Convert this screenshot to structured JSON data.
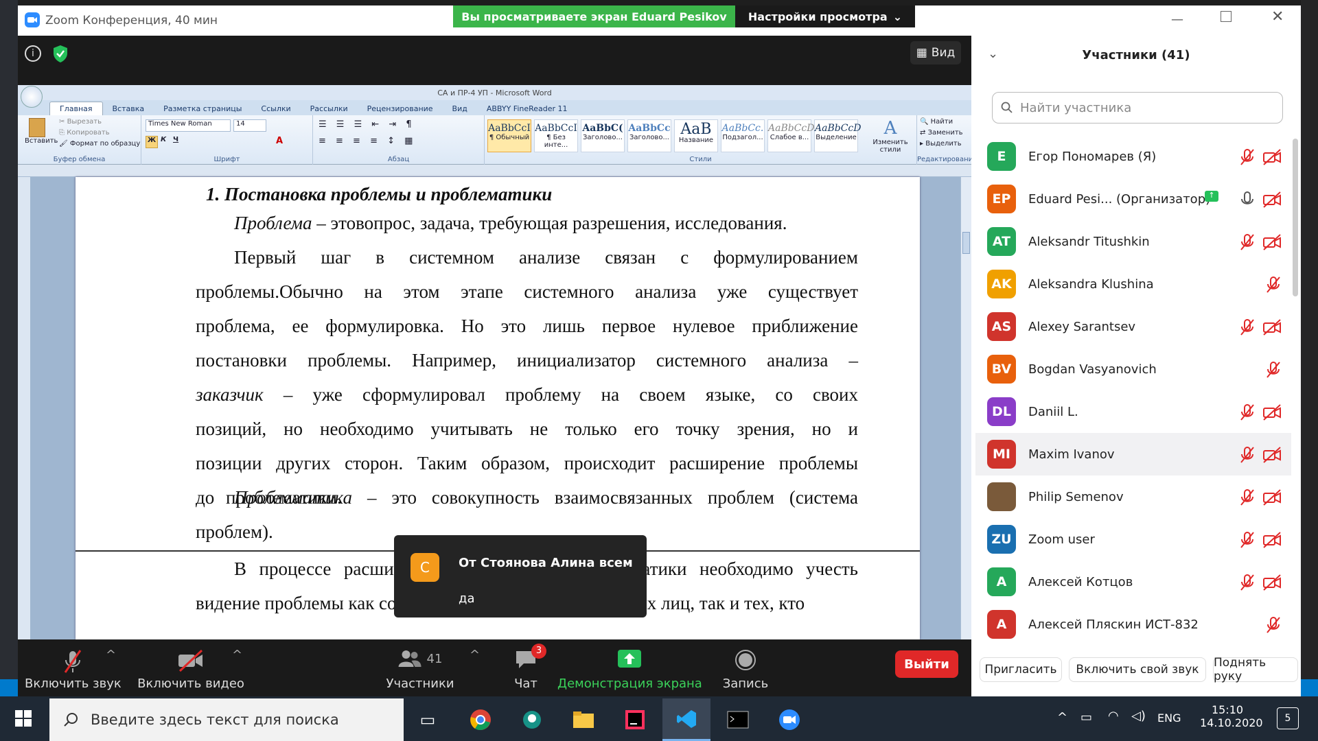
{
  "zoom": {
    "window_title": "Zoom Конференция, 40 мин",
    "share_banner": "Вы просматриваете экран Eduard Pesikov",
    "view_settings": "Настройки просмотра",
    "view_label": "Вид"
  },
  "word": {
    "title": "СА и ПР-4 УП - Microsoft Word",
    "tabs": [
      "Главная",
      "Вставка",
      "Разметка страницы",
      "Ссылки",
      "Рассылки",
      "Рецензирование",
      "Вид",
      "ABBYY FineReader 11"
    ],
    "clipboard": {
      "paste": "Вставить",
      "cut": "Вырезать",
      "copy": "Копировать",
      "format_painter": "Формат по образцу",
      "group": "Буфер обмена"
    },
    "font": {
      "name": "Times New Roman",
      "size": "14",
      "group": "Шрифт",
      "bold": "Ж",
      "italic": "К",
      "underline": "Ч"
    },
    "paragraph_group": "Абзац",
    "styles": [
      {
        "preview": "AaBbCcI",
        "name": "¶ Обычный"
      },
      {
        "preview": "AaBbCcI",
        "name": "¶ Без инте..."
      },
      {
        "preview": "AaBbC(",
        "name": "Заголово..."
      },
      {
        "preview": "AaBbCc",
        "name": "Заголово..."
      },
      {
        "preview": "AaB",
        "name": "Название"
      },
      {
        "preview": "AaBbCc.",
        "name": "Подзагол..."
      },
      {
        "preview": "AaBbCcD",
        "name": "Слабое в..."
      },
      {
        "preview": "AaBbCcD",
        "name": "Выделение"
      }
    ],
    "styles_group": "Стили",
    "change_styles": "Изменить стили",
    "editing": {
      "find": "Найти",
      "replace": "Заменить",
      "select": "Выделить",
      "group": "Редактирование"
    },
    "heading": "1.  Постановка проблемы и проблематики",
    "p1_term": "Проблема",
    "p1_rest": " – этовопрос, задача, требующая разрешения, исследования.",
    "p2": "Первый шаг в системном анализе связан с формулированием проблемы.Обычно на этом этапе системного анализа уже существует проблема, ее формулировка. Но это лишь первое нулевое приближение постановки проблемы. Например, инициализатор системного анализа –",
    "p2_term": "заказчик",
    "p2_rest": " – уже сформулировал проблему на своем языке, со своих позиций, но необходимо учитывать не только его точку зрения, но и позиции других сторон. Таким образом, происходит расширение проблемы до проблематики.",
    "p3_term": "Проблематика",
    "p3_rest": " – это совокупность взаимосвязанных проблем (система проблем).",
    "p4": "В процессе расширения проблемы до проблематики необходимо учесть видение проблемы как со стороны всех заинтересованных лиц, так и тех, кто"
  },
  "chat_toast": {
    "avatar": "С",
    "from": "От Стоянова Алина всем",
    "message": "да"
  },
  "controls": {
    "unmute": "Включить звук",
    "start_video": "Включить видео",
    "participants": "Участники",
    "participants_count": "41",
    "chat": "Чат",
    "chat_badge": "3",
    "share": "Демонстрация экрана",
    "record": "Запись",
    "leave": "Выйти"
  },
  "panel": {
    "title": "Участники (41)",
    "search_placeholder": "Найти участника",
    "participants": [
      {
        "initials": "E",
        "name": "Егор Пономарев (Я)",
        "color": "#25a85a"
      },
      {
        "initials": "EP",
        "name": "Eduard Pesi...  (Организатор)",
        "color": "#e8600c"
      },
      {
        "initials": "AT",
        "name": "Aleksandr Titushkin",
        "color": "#25a85a"
      },
      {
        "initials": "AK",
        "name": "Aleksandra Klushina",
        "color": "#f0a000"
      },
      {
        "initials": "AS",
        "name": "Alexey Sarantsev",
        "color": "#d0342c"
      },
      {
        "initials": "BV",
        "name": "Bogdan Vasyanovich",
        "color": "#e8600c"
      },
      {
        "initials": "DL",
        "name": "Daniil L.",
        "color": "#8a3dc8"
      },
      {
        "initials": "MI",
        "name": "Maxim Ivanov",
        "color": "#d0342c"
      },
      {
        "initials": "",
        "name": "Philip Semenov",
        "color": "#7a5a3a"
      },
      {
        "initials": "ZU",
        "name": "Zoom user",
        "color": "#1a6fb0"
      },
      {
        "initials": "A",
        "name": "Алексей Котцов",
        "color": "#25a85a"
      },
      {
        "initials": "A",
        "name": "Алексей Пляскин ИСТ-832",
        "color": "#d0342c"
      }
    ],
    "invite": "Пригласить",
    "unmute_me": "Включить свой звук",
    "raise_hand": "Поднять руку"
  },
  "taskbar": {
    "search_placeholder": "Введите здесь текст для поиска",
    "lang": "ENG",
    "time": "15:10",
    "date": "14.10.2020",
    "notifications": "5"
  }
}
